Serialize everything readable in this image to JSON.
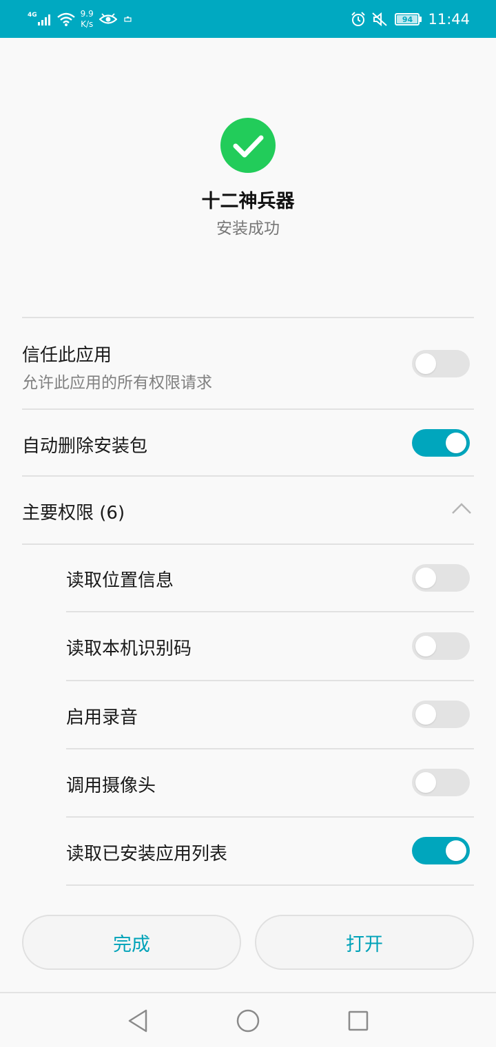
{
  "status_bar": {
    "network_type": "4G",
    "speed_value": "9.9",
    "speed_unit": "K/s",
    "battery_level": "94",
    "time": "11:44",
    "icons": [
      "signal-icon",
      "wifi-icon",
      "eye-icon",
      "notification-icon",
      "alarm-icon",
      "mute-icon",
      "battery-icon"
    ]
  },
  "app": {
    "name": "十二神兵器",
    "status": "安装成功"
  },
  "settings": {
    "trust": {
      "title": "信任此应用",
      "subtitle": "允许此应用的所有权限请求",
      "enabled": false
    },
    "auto_delete": {
      "title": "自动删除安装包",
      "enabled": true
    },
    "permissions_header": "主要权限 (6)",
    "permissions": [
      {
        "label": "读取位置信息",
        "enabled": false
      },
      {
        "label": "读取本机识别码",
        "enabled": false
      },
      {
        "label": "启用录音",
        "enabled": false
      },
      {
        "label": "调用摄像头",
        "enabled": false
      },
      {
        "label": "读取已安装应用列表",
        "enabled": true
      }
    ]
  },
  "buttons": {
    "done": "完成",
    "open": "打开"
  },
  "colors": {
    "accent": "#00a9c1",
    "success": "#22cc5a"
  }
}
